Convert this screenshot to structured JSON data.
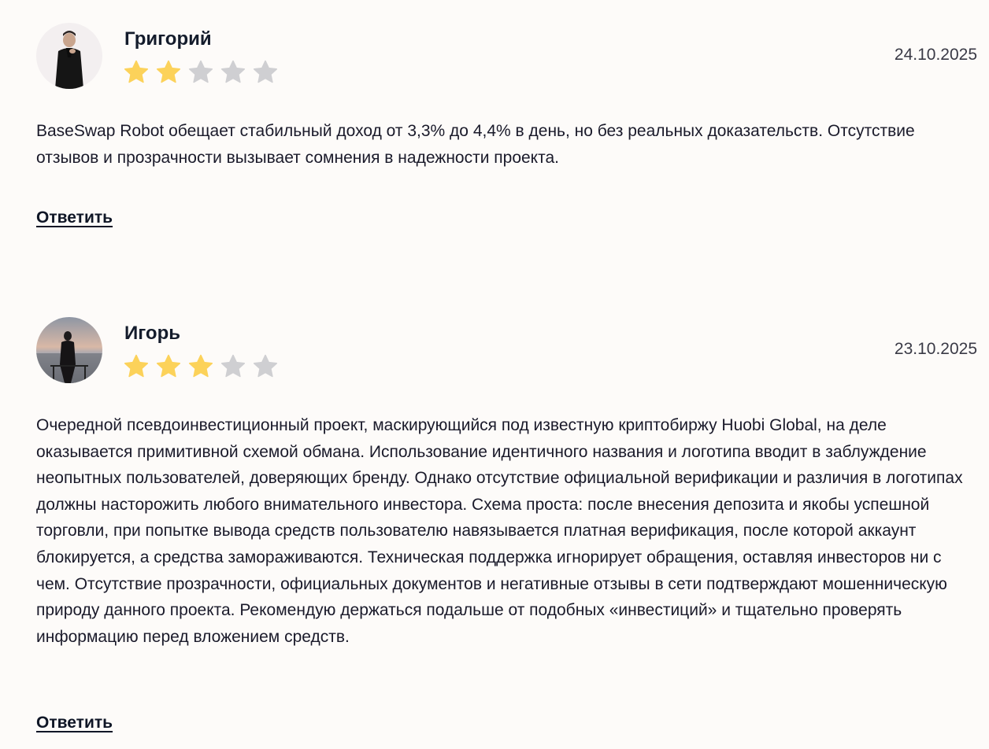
{
  "reviews": [
    {
      "author": "Григорий",
      "date": "24.10.2025",
      "rating": 2,
      "max_rating": 5,
      "text": "BaseSwap Robot обещает стабильный доход от 3,3% до 4,4% в день, но без реальных доказательств. Отсутствие отзывов и прозрачности вызывает сомнения в надежности проекта.",
      "reply_label": "Ответить"
    },
    {
      "author": "Игорь",
      "date": "23.10.2025",
      "rating": 3,
      "max_rating": 5,
      "text": "Очередной псевдоинвестиционный проект, маскирующийся под известную криптобиржу Huobi Global, на деле оказывается примитивной схемой обмана. Использование идентичного названия и логотипа вводит в заблуждение неопытных пользователей, доверяющих бренду. Однако отсутствие официальной верификации и различия в логотипах должны насторожить любого внимательного инвестора. Схема проста: после внесения депозита и якобы успешной торговли, при попытке вывода средств пользователю навязывается платная верификация, после которой аккаунт блокируется, а средства замораживаются. Техническая поддержка игнорирует обращения, оставляя инвесторов ни с чем. Отсутствие прозрачности, официальных документов и негативные отзывы в сети подтверждают мошенническую природу данного проекта. Рекомендую держаться подальше от подобных «инвестиций» и тщательно проверять информацию перед вложением средств.",
      "reply_label": "Ответить"
    }
  ],
  "colors": {
    "star_filled": "#fcd25a",
    "star_empty": "#cfcfd2",
    "background": "#fdfbf9",
    "text": "#1a1a2a"
  }
}
